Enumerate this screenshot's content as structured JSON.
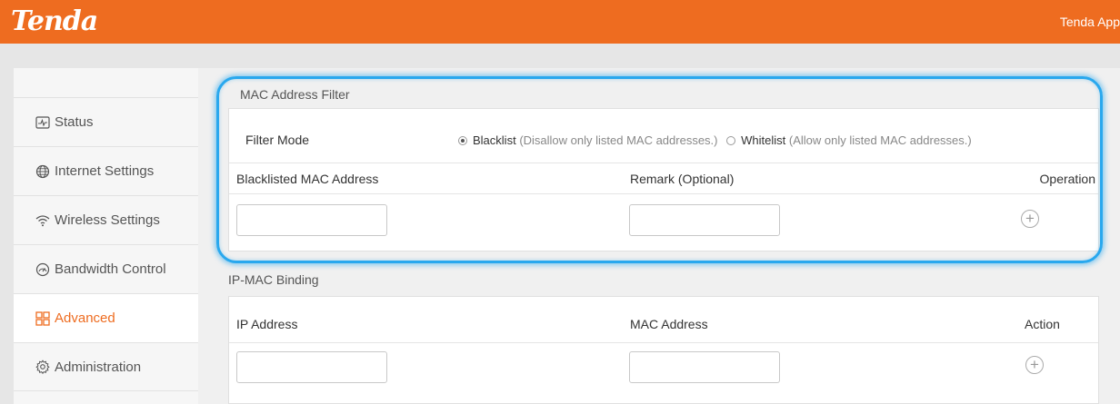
{
  "header": {
    "logo": "Tenda",
    "app_link": "Tenda App"
  },
  "sidebar": {
    "items": [
      {
        "label": "Status",
        "icon": "status-icon"
      },
      {
        "label": "Internet Settings",
        "icon": "globe-icon"
      },
      {
        "label": "Wireless Settings",
        "icon": "wifi-icon"
      },
      {
        "label": "Bandwidth Control",
        "icon": "gauge-icon"
      },
      {
        "label": "Advanced",
        "icon": "grid-icon",
        "active": true
      },
      {
        "label": "Administration",
        "icon": "gear-icon"
      }
    ]
  },
  "mac_filter": {
    "title": "MAC Address Filter",
    "filter_mode_label": "Filter Mode",
    "blacklist_label": "Blacklist",
    "blacklist_desc": "(Disallow only listed MAC addresses.)",
    "whitelist_label": "Whitelist",
    "whitelist_desc": "(Allow only listed MAC addresses.)",
    "selected_mode": "Blacklist",
    "columns": [
      "Blacklisted MAC Address",
      "Remark (Optional)",
      "Operation"
    ],
    "mac_value": "",
    "remark_value": ""
  },
  "ip_mac": {
    "title": "IP-MAC Binding",
    "columns": [
      "IP Address",
      "MAC Address",
      "Action"
    ],
    "ip_value": "",
    "mac_value": ""
  },
  "colors": {
    "brand": "#ee6c20",
    "highlight": "#29a8ee"
  }
}
